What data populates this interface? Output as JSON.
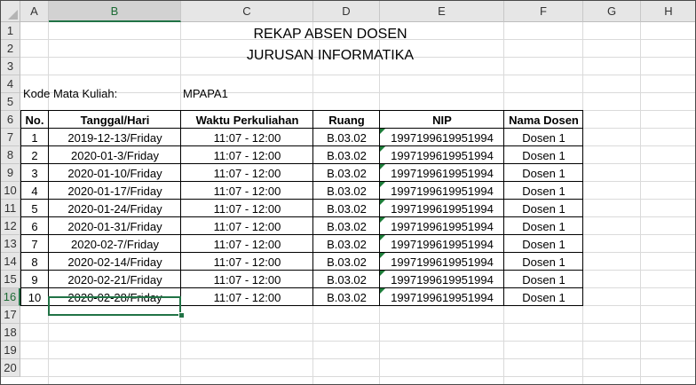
{
  "columns": [
    "A",
    "B",
    "C",
    "D",
    "E",
    "F",
    "G",
    "H"
  ],
  "rows": [
    "1",
    "2",
    "3",
    "4",
    "5",
    "6",
    "7",
    "8",
    "9",
    "10",
    "11",
    "12",
    "13",
    "14",
    "15",
    "16",
    "17",
    "18",
    "19",
    "20"
  ],
  "selected_column": "B",
  "selected_row": "16",
  "title1": "REKAP ABSEN DOSEN",
  "title2": "JURUSAN INFORMATIKA",
  "course_label": "Kode Mata Kuliah:",
  "course_value": "MPAPA1",
  "headers": {
    "no": "No.",
    "date": "Tanggal/Hari",
    "time": "Waktu Perkuliahan",
    "room": "Ruang",
    "nip": "NIP",
    "lecturer": "Nama Dosen"
  },
  "records": [
    {
      "no": "1",
      "date": "2019-12-13/Friday",
      "time": "11:07 - 12:00",
      "room": "B.03.02",
      "nip": "1997199619951994",
      "lecturer": "Dosen 1"
    },
    {
      "no": "2",
      "date": "2020-01-3/Friday",
      "time": "11:07 - 12:00",
      "room": "B.03.02",
      "nip": "1997199619951994",
      "lecturer": "Dosen 1"
    },
    {
      "no": "3",
      "date": "2020-01-10/Friday",
      "time": "11:07 - 12:00",
      "room": "B.03.02",
      "nip": "1997199619951994",
      "lecturer": "Dosen 1"
    },
    {
      "no": "4",
      "date": "2020-01-17/Friday",
      "time": "11:07 - 12:00",
      "room": "B.03.02",
      "nip": "1997199619951994",
      "lecturer": "Dosen 1"
    },
    {
      "no": "5",
      "date": "2020-01-24/Friday",
      "time": "11:07 - 12:00",
      "room": "B.03.02",
      "nip": "1997199619951994",
      "lecturer": "Dosen 1"
    },
    {
      "no": "6",
      "date": "2020-01-31/Friday",
      "time": "11:07 - 12:00",
      "room": "B.03.02",
      "nip": "1997199619951994",
      "lecturer": "Dosen 1"
    },
    {
      "no": "7",
      "date": "2020-02-7/Friday",
      "time": "11:07 - 12:00",
      "room": "B.03.02",
      "nip": "1997199619951994",
      "lecturer": "Dosen 1"
    },
    {
      "no": "8",
      "date": "2020-02-14/Friday",
      "time": "11:07 - 12:00",
      "room": "B.03.02",
      "nip": "1997199619951994",
      "lecturer": "Dosen 1"
    },
    {
      "no": "9",
      "date": "2020-02-21/Friday",
      "time": "11:07 - 12:00",
      "room": "B.03.02",
      "nip": "1997199619951994",
      "lecturer": "Dosen 1"
    },
    {
      "no": "10",
      "date": "2020-02-28/Friday",
      "time": "11:07 - 12:00",
      "room": "B.03.02",
      "nip": "1997199619951994",
      "lecturer": "Dosen 1"
    }
  ],
  "colors": {
    "accent": "#217346",
    "header_bg": "#e6e6e6",
    "gridline": "#dadada",
    "number_as_text_marker": "#1d7f3a"
  }
}
